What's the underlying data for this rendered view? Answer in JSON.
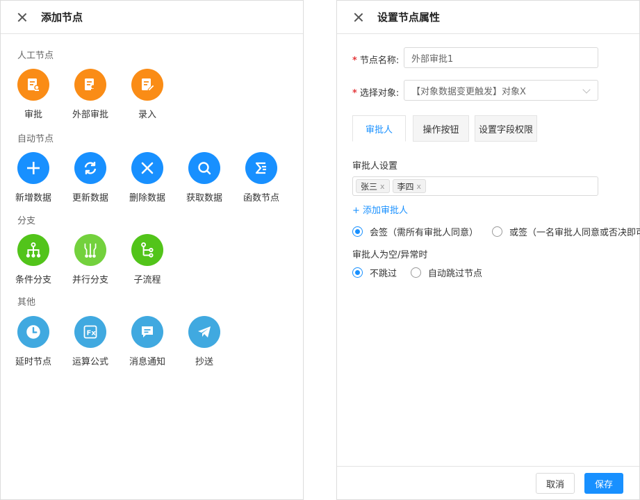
{
  "left": {
    "title": "添加节点",
    "sections": {
      "manual": "人工节点",
      "auto": "自动节点",
      "branch": "分支",
      "other": "其他"
    },
    "manual_nodes": [
      "审批",
      "外部审批",
      "录入"
    ],
    "auto_nodes": [
      "新增数据",
      "更新数据",
      "删除数据",
      "获取数据",
      "函数节点"
    ],
    "branch_nodes": [
      "条件分支",
      "并行分支",
      "子流程"
    ],
    "other_nodes": [
      "延时节点",
      "运算公式",
      "消息通知",
      "抄送"
    ]
  },
  "right": {
    "title": "设置节点属性",
    "node_name_label": "节点名称:",
    "node_name_value": "外部审批1",
    "object_label": "选择对象:",
    "object_value": "【对象数据变更触发】对象X",
    "tabs": [
      "审批人",
      "操作按钮",
      "设置字段权限"
    ],
    "approver_setting_label": "审批人设置",
    "approvers": [
      "张三",
      "李四"
    ],
    "tag_remove": "x",
    "add_approver": "+ 添加审批人",
    "sign_options": [
      "会签（需所有审批人同意）",
      "或签（一名审批人同意或否决即可）"
    ],
    "empty_label": "审批人为空/异常时",
    "empty_options": [
      "不跳过",
      "自动跳过节点"
    ],
    "cancel": "取消",
    "save": "保存"
  },
  "colors": {
    "accent": "#1890ff",
    "orange": "#fa8c16",
    "green": "#52c41a",
    "cyan": "#40a9e0",
    "required": "#e4393c"
  }
}
